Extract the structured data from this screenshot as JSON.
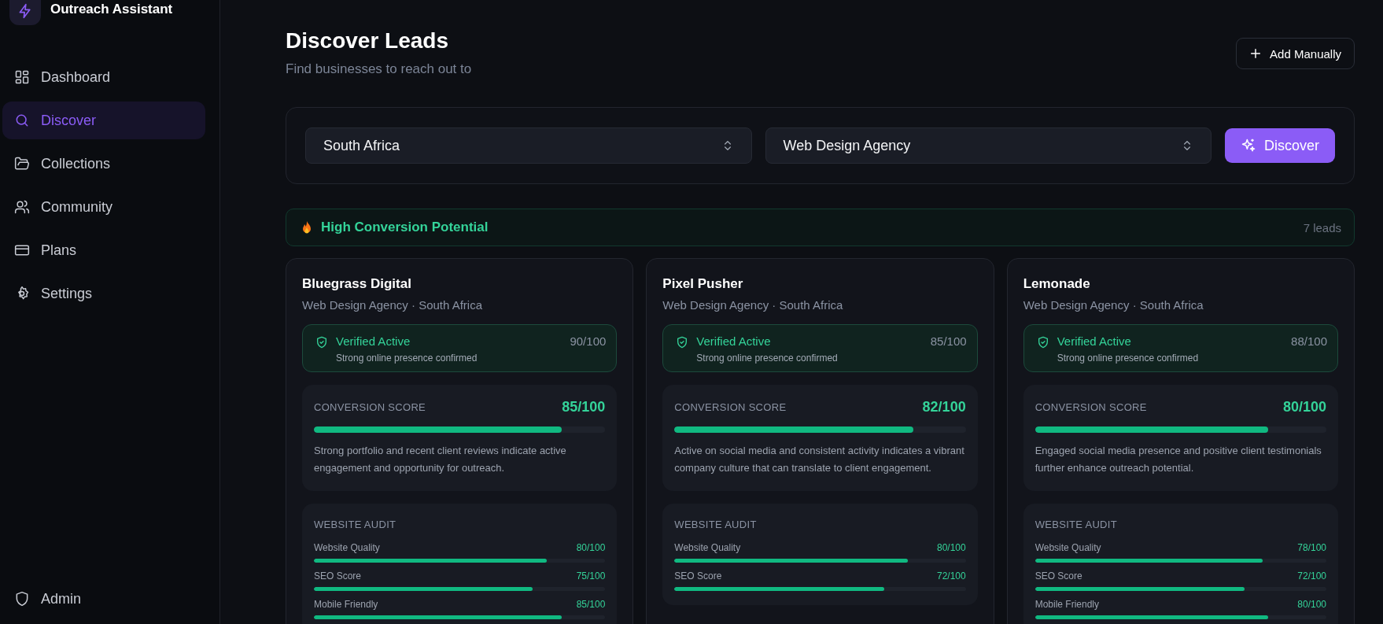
{
  "sidebar": {
    "brand": "Outreach Assistant",
    "nav": [
      {
        "label": "Dashboard",
        "selected": false
      },
      {
        "label": "Discover",
        "selected": true
      },
      {
        "label": "Collections",
        "selected": false
      },
      {
        "label": "Community",
        "selected": false
      },
      {
        "label": "Plans",
        "selected": false
      },
      {
        "label": "Settings",
        "selected": false
      }
    ],
    "footer_item": {
      "label": "Admin"
    }
  },
  "header": {
    "title": "Discover Leads",
    "subtitle": "Find businesses to reach out to",
    "action": "Add Manually"
  },
  "filters": {
    "country": "South Africa",
    "industry": "Web Design Agency",
    "submit": "Discover"
  },
  "section": {
    "title": "High Conversion Potential",
    "count": "7 leads"
  },
  "cards": [
    {
      "name": "Bluegrass Digital",
      "meta": "Web Design Agency · South Africa",
      "verification": {
        "label": "Verified Active",
        "note": "Strong online presence confirmed",
        "score": "90/100"
      },
      "conversion": {
        "label": "CONVERSION SCORE",
        "score": "85/100",
        "level": 0.85,
        "summary": "Strong portfolio and recent client reviews indicate active engagement and opportunity for outreach."
      },
      "audit": {
        "label": "WEBSITE AUDIT",
        "metrics": [
          {
            "label": "Website Quality",
            "score": "80/100",
            "level": 0.8
          },
          {
            "label": "SEO Score",
            "score": "75/100",
            "level": 0.75
          },
          {
            "label": "Mobile Friendly",
            "score": "85/100",
            "level": 0.85
          }
        ]
      }
    },
    {
      "name": "Pixel Pusher",
      "meta": "Web Design Agency · South Africa",
      "verification": {
        "label": "Verified Active",
        "note": "Strong online presence confirmed",
        "score": "85/100"
      },
      "conversion": {
        "label": "CONVERSION SCORE",
        "score": "82/100",
        "level": 0.82,
        "summary": "Active on social media and consistent activity indicates a vibrant company culture that can translate to client engagement."
      },
      "audit": {
        "label": "WEBSITE AUDIT",
        "metrics": [
          {
            "label": "Website Quality",
            "score": "80/100",
            "level": 0.8
          },
          {
            "label": "SEO Score",
            "score": "72/100",
            "level": 0.72
          }
        ]
      }
    },
    {
      "name": "Lemonade",
      "meta": "Web Design Agency · South Africa",
      "verification": {
        "label": "Verified Active",
        "note": "Strong online presence confirmed",
        "score": "88/100"
      },
      "conversion": {
        "label": "CONVERSION SCORE",
        "score": "80/100",
        "level": 0.8,
        "summary": "Engaged social media presence and positive client testimonials further enhance outreach potential."
      },
      "audit": {
        "label": "WEBSITE AUDIT",
        "metrics": [
          {
            "label": "Website Quality",
            "score": "78/100",
            "level": 0.78
          },
          {
            "label": "SEO Score",
            "score": "72/100",
            "level": 0.72
          },
          {
            "label": "Mobile Friendly",
            "score": "80/100",
            "level": 0.8
          }
        ]
      }
    }
  ]
}
